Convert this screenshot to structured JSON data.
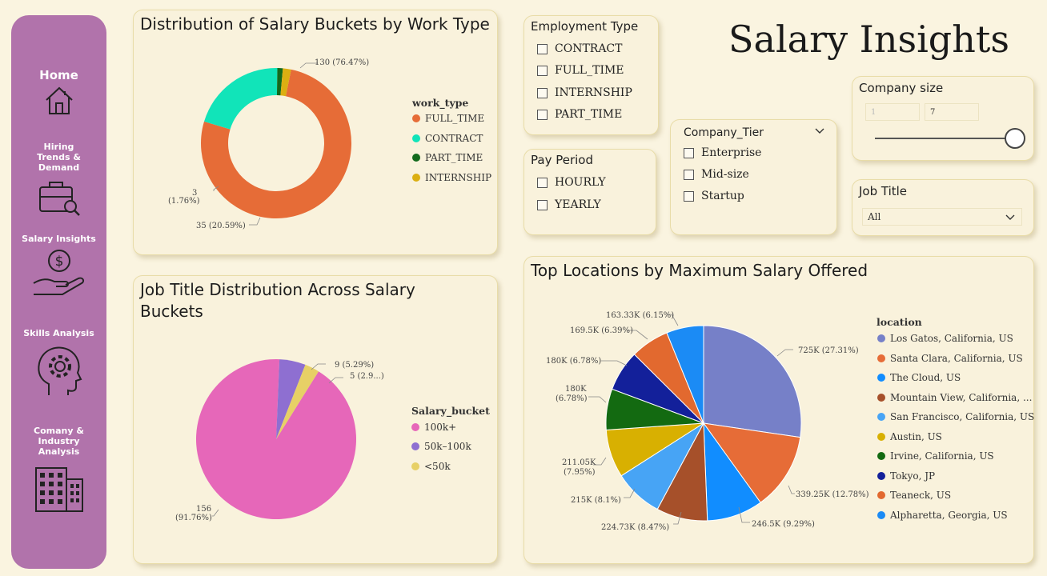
{
  "page_title": "Salary Insights",
  "sidebar": {
    "items": [
      {
        "label": "Home"
      },
      {
        "label": "Hiring Trends & Demand"
      },
      {
        "label": "Salary Insights"
      },
      {
        "label": "Skills Analysis"
      },
      {
        "label": "Comany & Industry Analysis"
      }
    ]
  },
  "work_type_chart": {
    "title": "Distribution of Salary Buckets by Work Type",
    "legend_title": "work_type",
    "legend": [
      "FULL_TIME",
      "CONTRACT",
      "PART_TIME",
      "INTERNSHIP"
    ],
    "labels": {
      "full_time": "130 (76.47%)",
      "contract": "35 (20.59%)",
      "internship_a": "3",
      "internship_b": "(1.76%)"
    }
  },
  "job_title_chart": {
    "title_line1": "Job Title Distribution Across Salary",
    "title_line2": "Buckets",
    "legend_title": "Salary_bucket",
    "legend": [
      "100k+",
      "50k–100k",
      "<50k"
    ],
    "labels": {
      "mid": "9 (5.29%)",
      "low": "5 (2.9...)",
      "big_a": "156",
      "big_b": "(91.76%)"
    }
  },
  "location_chart": {
    "title": "Top Locations by Maximum Salary Offered",
    "legend_title": "location",
    "legend": [
      "Los Gatos, California, US",
      "Santa Clara, California, US",
      "The Cloud, US",
      "Mountain View, California, ...",
      "San Francisco, California, US",
      "Austin, US",
      "Irvine, California, US",
      "Tokyo, JP",
      "Teaneck, US",
      "Alpharetta, Georgia, US"
    ],
    "labels": [
      "725K (27.31%)",
      "339.25K (12.78%)",
      "246.5K (9.29%)",
      "224.73K (8.47%)",
      "215K (8.1%)",
      "211.05K",
      "(7.95%)",
      "180K",
      "(6.78%)",
      "180K (6.78%)",
      "169.5K (6.39%)",
      "163.33K (6.15%)"
    ]
  },
  "employment_type": {
    "title": "Employment Type",
    "options": [
      "CONTRACT",
      "FULL_TIME",
      "INTERNSHIP",
      "PART_TIME"
    ]
  },
  "pay_period": {
    "title": "Pay Period",
    "options": [
      "HOURLY",
      "YEARLY"
    ]
  },
  "company_tier": {
    "title": "Company_Tier",
    "options": [
      "Enterprise",
      "Mid-size",
      "Startup"
    ]
  },
  "company_size": {
    "title": "Company size",
    "min": "1",
    "max": "7"
  },
  "job_title": {
    "title": "Job Title",
    "selected": "All"
  },
  "chart_data": [
    {
      "type": "pie",
      "title": "Distribution of Salary Buckets by Work Type",
      "legend_title": "work_type",
      "categories": [
        "FULL_TIME",
        "CONTRACT",
        "PART_TIME",
        "INTERNSHIP"
      ],
      "values": [
        130,
        35,
        2,
        3
      ],
      "colors": [
        "#e66c37",
        "#11e4b9",
        "#136a1d",
        "#dbaf12"
      ],
      "donut": true
    },
    {
      "type": "pie",
      "title": "Job Title Distribution Across Salary Buckets",
      "legend_title": "Salary_bucket",
      "categories": [
        "100k+",
        "50k–100k",
        "<50k"
      ],
      "values": [
        156,
        9,
        5
      ],
      "colors": [
        "#e667b9",
        "#8e6fd1",
        "#e7d066"
      ]
    },
    {
      "type": "pie",
      "title": "Top Locations by Maximum Salary Offered",
      "legend_title": "location",
      "categories": [
        "Los Gatos, California, US",
        "Santa Clara, California, US",
        "The Cloud, US",
        "Mountain View, California, ...",
        "San Francisco, California, US",
        "Austin, US",
        "Irvine, California, US",
        "Tokyo, JP",
        "Teaneck, US",
        "Alpharetta, Georgia, US"
      ],
      "values": [
        725,
        339.25,
        246.5,
        224.73,
        215,
        211.05,
        180,
        180,
        169.5,
        163.33
      ],
      "colors": [
        "#7680c8",
        "#e66c37",
        "#118dff",
        "#a6502a",
        "#47a4f5",
        "#d8b001",
        "#136a11",
        "#13209a",
        "#e2692f",
        "#1b8bf5"
      ]
    }
  ]
}
